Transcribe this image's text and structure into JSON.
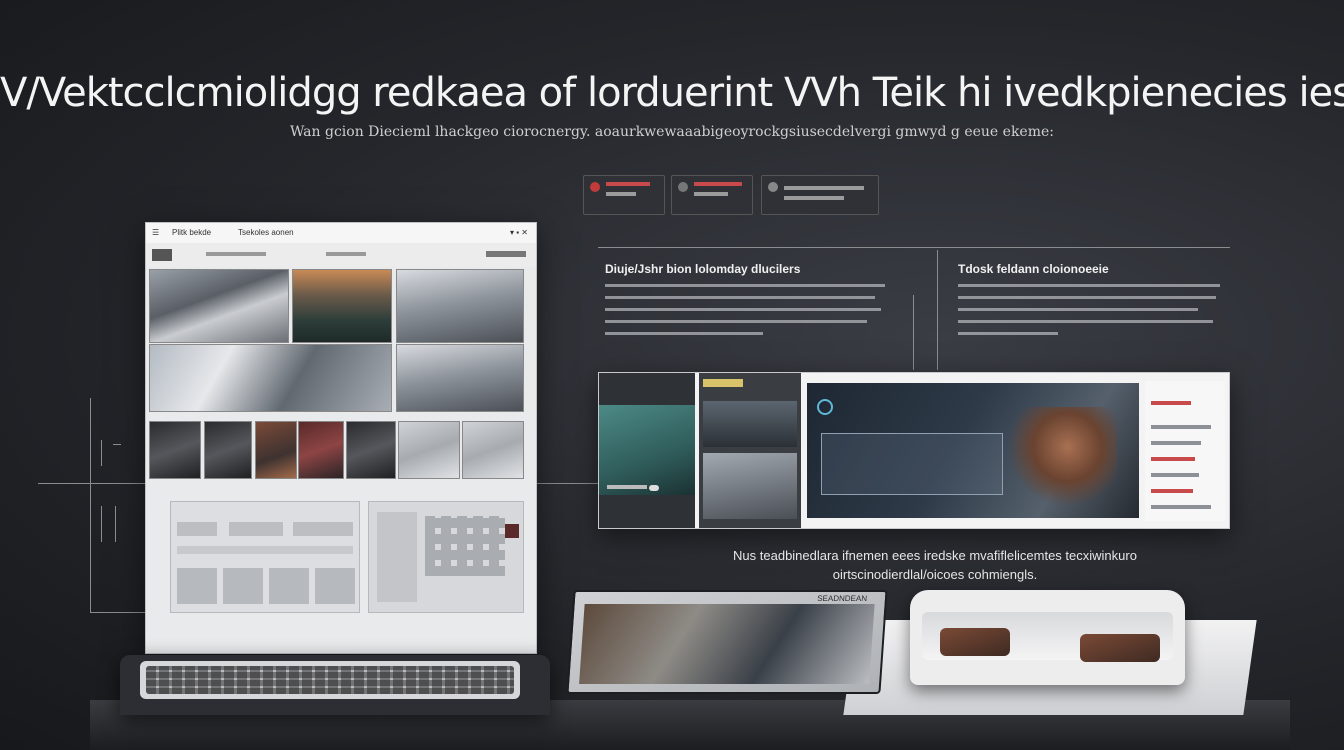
{
  "header": {
    "title": "V/Vektcclcmiolidgg redkaea of lorduerint VVh Teik hi ivedkpienecies ies",
    "subtitle": "Wan gcion Diecieml lhackgeo ciorocnergy. aoaurkwewaaabigeoyrockgsiusecdelvergi gmwyd g eeue ekeme:"
  },
  "left_monitor": {
    "window_title": "Plitk bekde",
    "toolbar_label": "Tsekoles aonen"
  },
  "section_left": {
    "heading": "Diuje/Jshr bion lolomday dlucilers"
  },
  "section_right": {
    "heading": "Tdosk feldann cloionoeeie"
  },
  "note": {
    "line1": "Nus teadbinedlara ifnemen eees iredske mvafiflelicemtes tecxiwinkuro",
    "line2": "oirtscinodierdlal/oicoes cohmiengls."
  },
  "tablet": {
    "label": "SEADNDEAN"
  },
  "colors": {
    "background": "#24262b",
    "accent": "#c23b3b",
    "panel": "#f3f3f4"
  }
}
